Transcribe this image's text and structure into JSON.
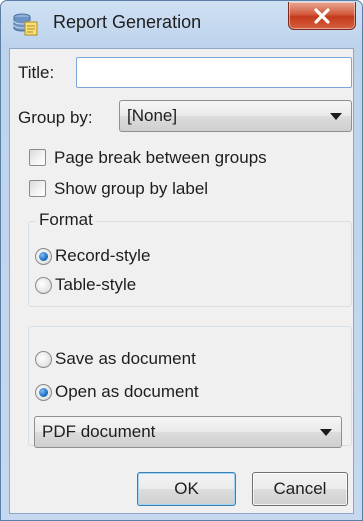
{
  "window": {
    "title": "Report Generation",
    "icon": "database-report-icon",
    "close_icon": "close-icon"
  },
  "form": {
    "title_label": "Title:",
    "title_value": "",
    "group_by_label": "Group by:",
    "group_by_value": "[None]",
    "page_break_label": "Page break between groups",
    "page_break_checked": false,
    "show_group_label": "Show group by label",
    "show_group_checked": false
  },
  "format": {
    "legend": "Format",
    "options": [
      {
        "label": "Record-style",
        "selected": true
      },
      {
        "label": "Table-style",
        "selected": false
      }
    ]
  },
  "output": {
    "options": [
      {
        "label": "Save as document",
        "selected": false
      },
      {
        "label": "Open as document",
        "selected": true
      }
    ],
    "document_type": "PDF document"
  },
  "buttons": {
    "ok": "OK",
    "cancel": "Cancel"
  },
  "colors": {
    "title_bar": "#c5d8ef",
    "close_button": "#c43a1b",
    "dialog_background": "#f0f0f0",
    "radio_selected": "#1f6fc2"
  }
}
